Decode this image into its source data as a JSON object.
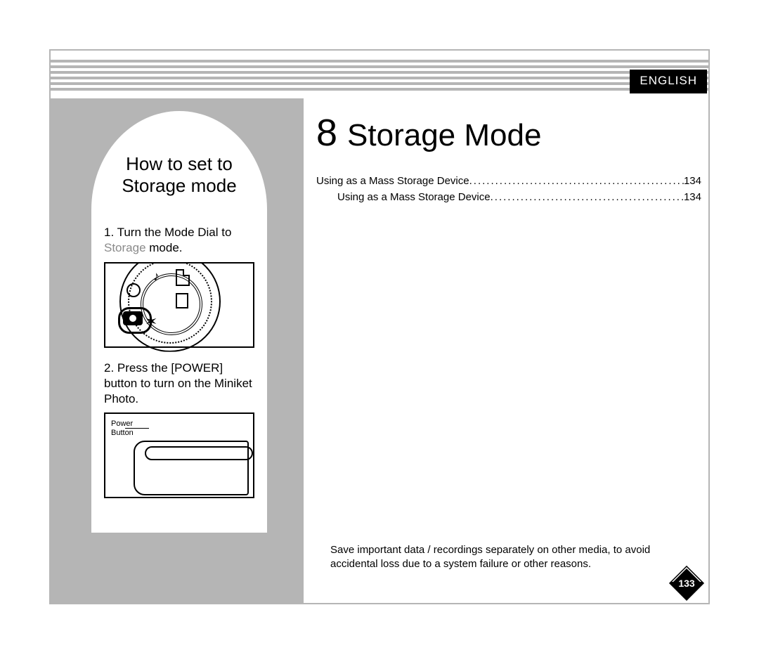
{
  "language_tab": "ENGLISH",
  "chapter": {
    "number": "8",
    "title": "Storage Mode"
  },
  "toc": [
    {
      "label": "Using as a Mass Storage Device",
      "page": "134",
      "indent": 0
    },
    {
      "label": "Using as a Mass Storage Device",
      "page": "134",
      "indent": 1
    }
  ],
  "sidebar": {
    "title_line1": "How to set to",
    "title_line2": "Storage mode",
    "step1_prefix": "1. Turn the Mode Dial to ",
    "step1_grey": "Storage",
    "step1_suffix": " mode.",
    "step2": "2. Press the [POWER] button to turn on the Miniket Photo.",
    "illus2_label_line1": "Power",
    "illus2_label_line2": "Button"
  },
  "footer_note": "Save important data / recordings separately on other media, to avoid accidental loss due to a system failure or other reasons.",
  "page_number": "133",
  "icons": {
    "camera": "camera-icon",
    "settings": "settings-gear-icon",
    "music": "music-note-icon",
    "storage": "storage-card-icon",
    "star": "star-icon",
    "file": "file-icon"
  }
}
